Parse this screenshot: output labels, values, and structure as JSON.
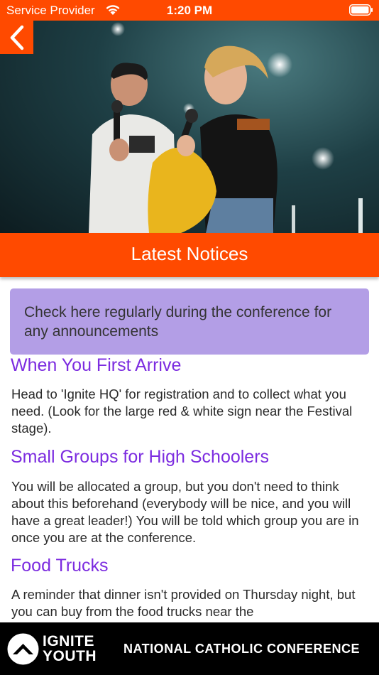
{
  "status_bar": {
    "carrier": "Service Provider",
    "time": "1:20 PM",
    "wifi_icon": "wifi-icon",
    "battery_icon": "battery-icon"
  },
  "hero": {
    "image": "photo of two speakers on stage holding microphones",
    "back_icon": "chevron-left-icon"
  },
  "page": {
    "title": "Latest Notices"
  },
  "notice": {
    "text": "Check here regularly during the conference for any announcements"
  },
  "sections": [
    {
      "heading": "When You First Arrive",
      "body": "Head to 'Ignite HQ' for registration and to collect what you need. (Look for the large red & white sign near the Festival stage)."
    },
    {
      "heading": "Small Groups for High Schoolers",
      "body": "You will be allocated a group, but you don't need to think about this beforehand (everybody will be nice, and you will have a great leader!) You will be told which group you are in once you are at the conference."
    },
    {
      "heading": "Food Trucks",
      "body": "A reminder that dinner isn't provided on Thursday night, but you can buy from the food trucks near the"
    }
  ],
  "footer": {
    "brand_line1": "IGNITE",
    "brand_line2": "YOUTH",
    "tagline": "NATIONAL CATHOLIC CONFERENCE",
    "logo_icon": "ignite-logo-icon"
  },
  "colors": {
    "accent": "#ff4a00",
    "heading": "#7c2ce0",
    "notice_bg": "#b39ee6",
    "footer_bg": "#000000"
  }
}
